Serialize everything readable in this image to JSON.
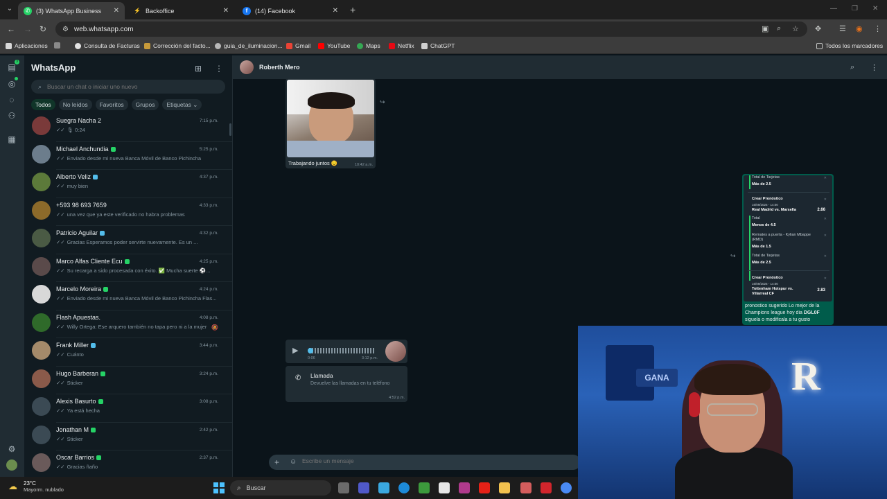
{
  "browser": {
    "tabs": [
      {
        "label": "(3) WhatsApp Business",
        "icon": "whatsapp-icon",
        "active": true
      },
      {
        "label": "Backoffice",
        "icon": "bolt-icon",
        "active": false
      },
      {
        "label": "(14) Facebook",
        "icon": "facebook-icon",
        "active": false
      }
    ],
    "url": "web.whatsapp.com",
    "bookmarks": [
      "Aplicaciones",
      "Consulta de Facturas",
      "Corrección del facto...",
      "guia_de_iluminacion...",
      "Gmail",
      "YouTube",
      "Maps",
      "Netflix",
      "ChatGPT"
    ],
    "all_bookmarks": "Todos los marcadores"
  },
  "rail": {
    "chat_badge": "3"
  },
  "sidebar": {
    "title": "WhatsApp",
    "search_placeholder": "Buscar un chat o iniciar uno nuevo",
    "filters": [
      "Todos",
      "No leídos",
      "Favoritos",
      "Grupos",
      "Etiquetas"
    ],
    "chats": [
      {
        "name": "Suegra Nacha 2",
        "time": "7:15 p.m.",
        "preview": "🎙 0:24",
        "badge": "",
        "avatar": "#7a3a3a"
      },
      {
        "name": "Michael Anchundia",
        "time": "5:25 p.m.",
        "preview": "Enviado desde mi nueva Banca Móvil de Banco Pichincha",
        "badge": "green",
        "avatar": "#6c7d8c"
      },
      {
        "name": "Alberto Veliz",
        "time": "4:37 p.m.",
        "preview": "muy bien",
        "badge": "blue",
        "avatar": "#5c7a3a"
      },
      {
        "name": "+593 98 693 7659",
        "time": "4:33 p.m.",
        "preview": "una vez que ya este verificado no habra problemas",
        "badge": "",
        "avatar": "#8c6a2a"
      },
      {
        "name": "Patricio Aguilar",
        "time": "4:32 p.m.",
        "preview": "Gracias Esperamos poder servirte nuevamente. Es un ...",
        "badge": "blue",
        "avatar": "#4a5a44"
      },
      {
        "name": "Marco Alfas Cliente Ecu",
        "time": "4:25 p.m.",
        "preview": "Su recarga a sido procesada con éxito. ✅ Mucha suerte ⚽...",
        "badge": "green",
        "avatar": "#5a4a4a"
      },
      {
        "name": "Marcelo Moreira",
        "time": "4:24 p.m.",
        "preview": "Enviado desde mi nueva Banca Móvil de Banco Pichincha Flas...",
        "badge": "green",
        "avatar": "#d8d8d8"
      },
      {
        "name": "Flash Apuestas.",
        "time": "4:08 p.m.",
        "preview": "Willy Ortega: Ese arquero también no tapa pero ni a la mujer",
        "badge": "",
        "avatar": "#2f6a2a"
      },
      {
        "name": "Frank Miller",
        "time": "3:44 p.m.",
        "preview": "Cuánto",
        "badge": "blue",
        "avatar": "#a48a6a"
      },
      {
        "name": "Hugo Barberan",
        "time": "3:24 p.m.",
        "preview": "Sticker",
        "badge": "green",
        "avatar": "#8a5a4a"
      },
      {
        "name": "Alexis Basurto",
        "time": "3:08 p.m.",
        "preview": "Ya está hecha",
        "badge": "green",
        "avatar": "#3b4a54"
      },
      {
        "name": "Jonathan M",
        "time": "2:42 p.m.",
        "preview": "Sticker",
        "badge": "green",
        "avatar": "#3b4a54"
      },
      {
        "name": "Oscar Barrios",
        "time": "2:37 p.m.",
        "preview": "Gracias ñaño",
        "badge": "green",
        "avatar": "#6a5a5a"
      }
    ]
  },
  "conversation": {
    "contact": "Roberth Mero",
    "image_caption": "Trabajando juntos 😌",
    "image_time": "10:42 a.m.",
    "card": {
      "rows": [
        {
          "label": "Total de Tarjetas",
          "value": "Más de 2.5"
        },
        {
          "label": "Crear Pronóstico",
          "match": "Real Madrid vs. Marsella",
          "odd": "2.66",
          "date": "16/09/2025 - 14:00"
        },
        {
          "label": "Total",
          "value": "Menos de 4.5"
        },
        {
          "label": "Remates a puerta - Kylian Mbappe (RMD)",
          "value": "Más de 1.5"
        },
        {
          "label": "Total de Tarjetas",
          "value": "Más de 2.5"
        },
        {
          "label": "Crear Pronóstico",
          "match": "Tottenham Hotspur vs. Villarreal CF",
          "odd": "2.83",
          "date": "16/09/2025 - 14:00"
        }
      ],
      "text_1": "pronostico sugerido Lo mejor de la Champions league hoy dia ",
      "text_bold": "DGL0F",
      "text_2": "siguela o modificala a tu gusto"
    },
    "audio_duration": "0:06",
    "audio_time": "3:12 p.m.",
    "call_title": "Llamada",
    "call_subtitle": "Devuelve las llamadas en tu teléfono",
    "call_time": "4:52 p.m.",
    "composer_placeholder": "Escribe un mensaje"
  },
  "webcam": {
    "sign": "GANA",
    "letter": "R"
  },
  "taskbar": {
    "temperature": "23°C",
    "weather": "Mayorm. nublado",
    "search": "Buscar"
  }
}
